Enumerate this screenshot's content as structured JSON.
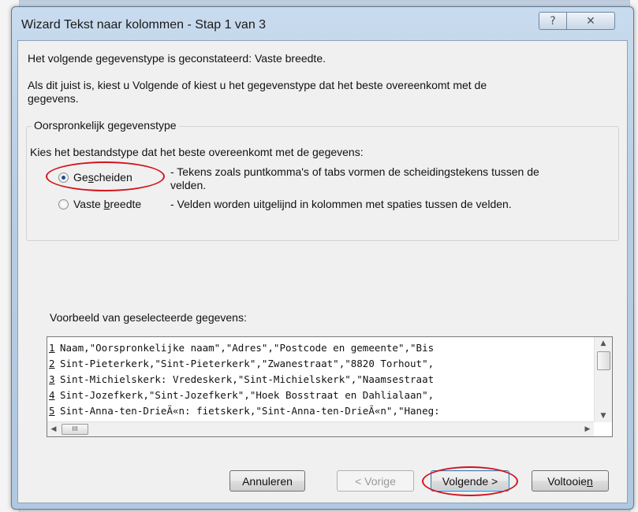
{
  "window": {
    "title": "Wizard Tekst naar kolommen - Stap 1 van 3",
    "help_glyph": "?",
    "close_glyph": "✕"
  },
  "intro": {
    "line1": "Het volgende gegevenstype is geconstateerd: Vaste breedte.",
    "line2": "Als dit juist is, kiest u Volgende of kiest u het gegevenstype dat het beste overeenkomt met de",
    "line3": "gegevens."
  },
  "group": {
    "legend": "Oorspronkelijk gegevenstype",
    "prompt": "Kies het bestandstype dat het beste overeenkomt met de gegevens:",
    "options": [
      {
        "label_pre": "Ge",
        "label_key": "s",
        "label_post": "cheiden",
        "desc_line1": "- Tekens zoals puntkomma's of tabs vormen de scheidingstekens tussen de",
        "desc_line2": "velden.",
        "selected": true
      },
      {
        "label_pre": "Vaste ",
        "label_key": "b",
        "label_post": "reedte",
        "desc_line1": "- Velden worden uitgelijnd in kolommen met spaties tussen de velden.",
        "selected": false
      }
    ]
  },
  "preview": {
    "label": "Voorbeeld van geselecteerde gegevens:",
    "rows": [
      {
        "num": "1",
        "text": "Naam,\"Oorspronkelijke naam\",\"Adres\",\"Postcode en gemeente\",\"Bis"
      },
      {
        "num": "2",
        "text": "Sint-Pieterkerk,\"Sint-Pieterkerk\",\"Zwanestraat\",\"8820 Torhout\","
      },
      {
        "num": "3",
        "text": "Sint-Michielskerk: Vredeskerk,\"Sint-Michielskerk\",\"Naamsestraat"
      },
      {
        "num": "4",
        "text": "Sint-Jozefkerk,\"Sint-Jozefkerk\",\"Hoek Bosstraat en Dahlialaan\","
      },
      {
        "num": "5",
        "text": "Sint-Anna-ten-DrieÃ«n: fietskerk,\"Sint-Anna-ten-DrieÃ«n\",\"Haneg:"
      }
    ],
    "up_arrow": "▲",
    "down_arrow": "▼",
    "left_arrow": "◀",
    "right_arrow": "▶",
    "thumb_grip": "III"
  },
  "buttons": {
    "cancel": "Annuleren",
    "back": "< Vorige",
    "next_pre": "Vol",
    "next_key": "g",
    "next_post": "ende >",
    "finish_pre": "Voltooie",
    "finish_key": "n"
  },
  "colors": {
    "annotation": "#d4141b",
    "title_bar": "#b7cde3"
  }
}
